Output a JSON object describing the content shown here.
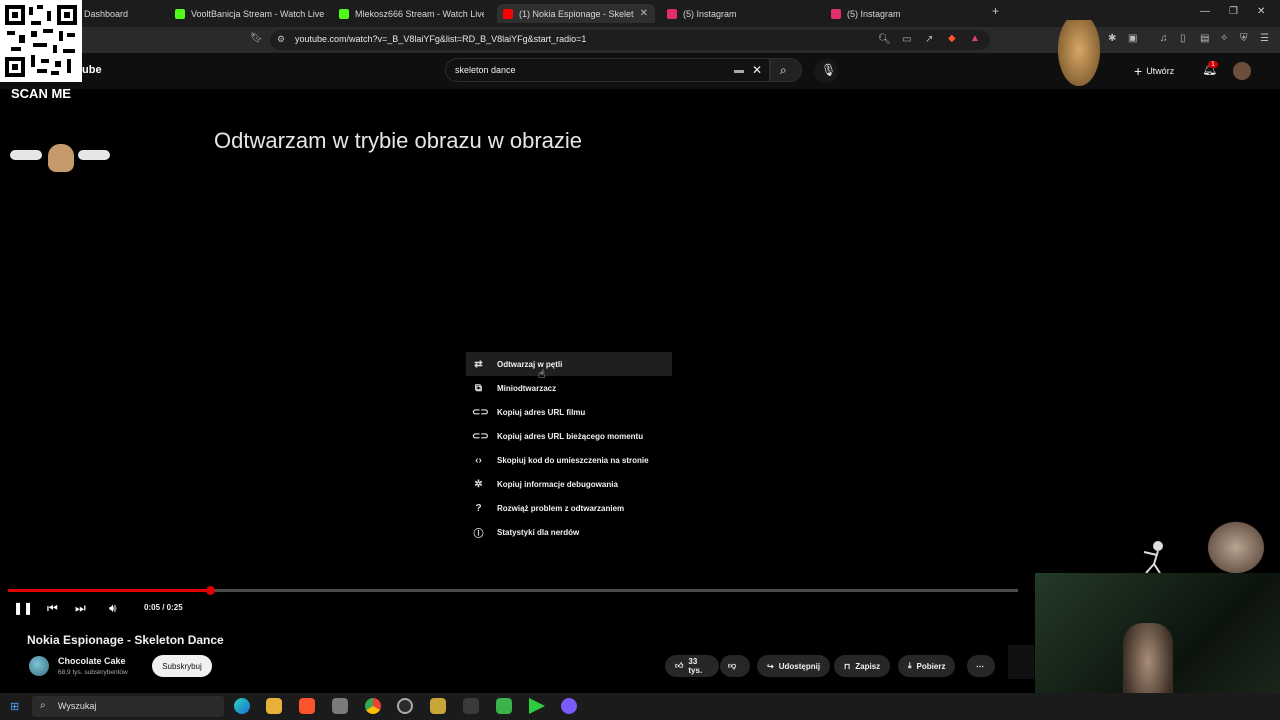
{
  "browser": {
    "tabs": [
      {
        "label": "Dashboard",
        "color": "#34c759"
      },
      {
        "label": "VooltBanicja Stream - Watch Live on",
        "color": "#53fc18"
      },
      {
        "label": "Mlekosz666 Stream - Watch Live on",
        "color": "#53fc18"
      },
      {
        "label": "(1) Nokia Espionage - Skelet",
        "color": "#ff0000"
      },
      {
        "label": "(5) Instagram",
        "color": "#e1306c"
      },
      {
        "label": "(5) Instagram",
        "color": "#e1306c"
      }
    ],
    "url": "youtube.com/watch?v=_B_V8laiYFg&list=RD_B_V8laiYFg&start_radio=1"
  },
  "youtube": {
    "logo_text": "ube",
    "search_value": "skeleton dance",
    "create_label": "Utwórz",
    "notification_count": "1"
  },
  "player": {
    "pip_message": "Odtwarzam w trybie obrazu w obrazie",
    "context_menu": [
      {
        "icon": "loop-icon",
        "label": "Odtwarzaj w pętli"
      },
      {
        "icon": "miniplayer-icon",
        "label": "Miniodtwarzacz"
      },
      {
        "icon": "link-icon",
        "label": "Kopiuj adres URL filmu"
      },
      {
        "icon": "link-icon",
        "label": "Kopiuj adres URL bieżącego momentu"
      },
      {
        "icon": "code-icon",
        "label": "Skopiuj kod do umieszczenia na stronie"
      },
      {
        "icon": "bug-icon",
        "label": "Kopiuj informacje debugowania"
      },
      {
        "icon": "help-icon",
        "label": "Rozwiąż problem z odtwarzaniem"
      },
      {
        "icon": "info-icon",
        "label": "Statystyki dla nerdów"
      }
    ],
    "time": "0:05 / 0:25",
    "progress": 0.2
  },
  "video": {
    "title": "Nokia Espionage - Skeleton Dance",
    "channel": "Chocolate Cake",
    "subscribers": "68,9 tys. subskrybentów",
    "subscribe_label": "Subskrybuj",
    "likes": "33 tys.",
    "share_label": "Udostępnij",
    "save_label": "Zapisz",
    "download_label": "Pobierz"
  },
  "overlay": {
    "scan_me": "SCAN ME"
  },
  "taskbar": {
    "search_label": "Wyszukaj"
  },
  "colors": {
    "accent_red": "#e10000",
    "background": "#0f0f0f"
  }
}
